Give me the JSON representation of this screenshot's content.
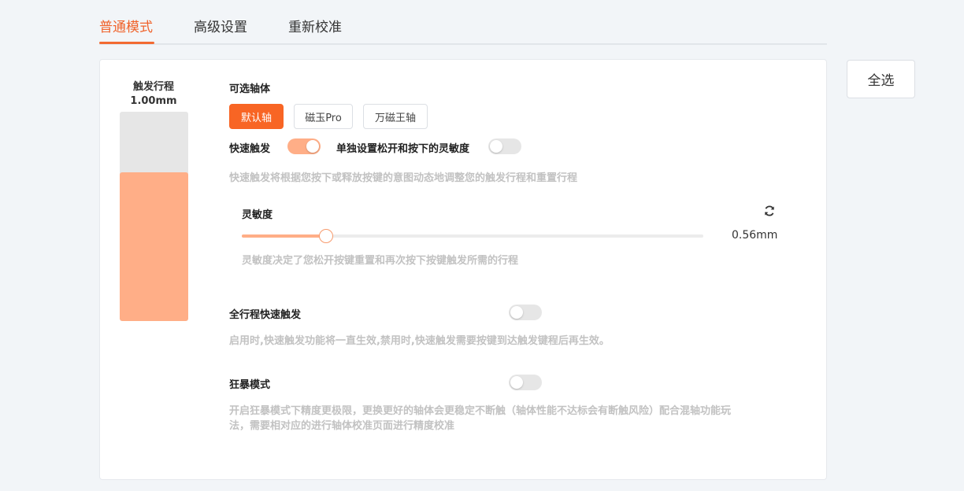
{
  "tabs": [
    {
      "label": "普通模式",
      "active": true
    },
    {
      "label": "高级设置",
      "active": false
    },
    {
      "label": "重新校准",
      "active": false
    }
  ],
  "select_all_label": "全选",
  "travel": {
    "title": "触发行程",
    "value_text": "1.00mm",
    "fill_fraction": 0.71
  },
  "axis": {
    "title": "可选轴体",
    "options": [
      {
        "label": "默认轴",
        "active": true
      },
      {
        "label": "磁玉Pro",
        "active": false
      },
      {
        "label": "万磁王轴",
        "active": false
      }
    ]
  },
  "rapid_trigger": {
    "label": "快速触发",
    "on": true
  },
  "separate_sensitivity": {
    "label": "单独设置松开和按下的灵敏度",
    "on": false
  },
  "rapid_desc": "快速触发将根据您按下或释放按键的意图动态地调整您的触发行程和重置行程",
  "sensitivity": {
    "label": "灵敏度",
    "value_text": "0.56mm",
    "fraction": 0.182,
    "desc": "灵敏度决定了您松开按键重置和再次按下按键触发所需的行程",
    "reset_icon": "refresh-icon"
  },
  "full_travel": {
    "label": "全行程快速触发",
    "on": false,
    "desc": "启用时,快速触发功能将一直生效,禁用时,快速触发需要按键到达触发键程后再生效。"
  },
  "turbo": {
    "label": "狂暴模式",
    "on": false,
    "desc_line1": "开启狂暴模式下精度更极限，更换更好的轴体会更稳定不断触（轴体性能不达标会有断触风险）配合混轴功能玩",
    "desc_line2": "法，需要相对应的进行轴体校准页面进行精度校准"
  },
  "colors": {
    "accent": "#f86524",
    "accent_light": "#ffae87",
    "muted_text": "#c2c2c2"
  }
}
